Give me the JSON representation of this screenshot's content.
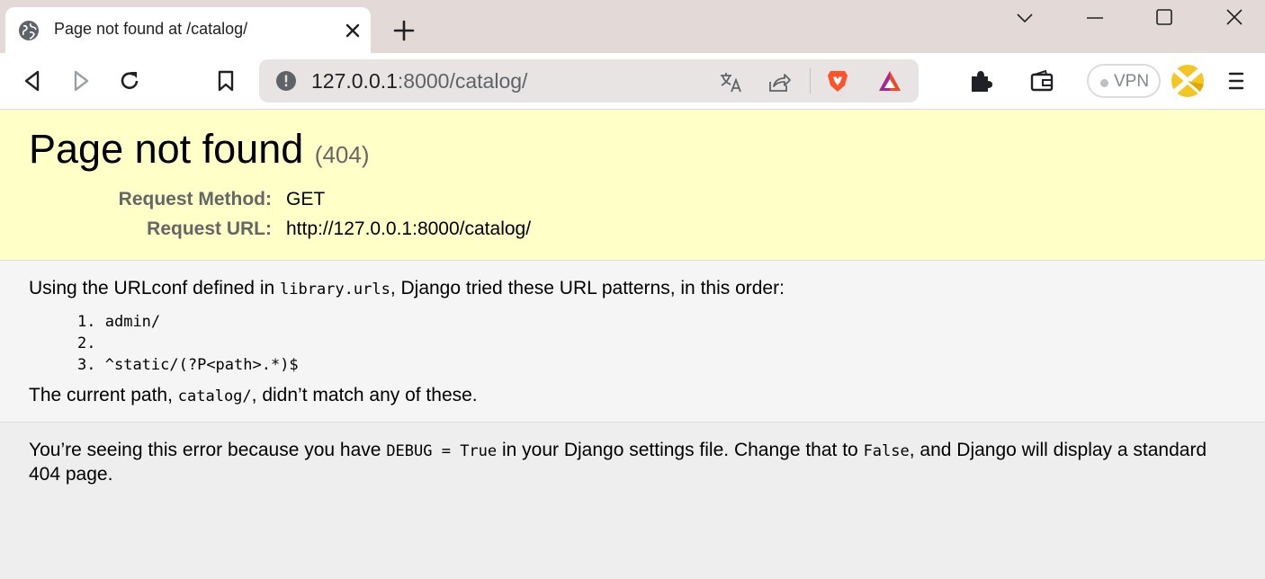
{
  "browser": {
    "tab": {
      "title": "Page not found at /catalog/",
      "favicon": "globe-icon"
    },
    "toolbar": {
      "url_host": "127.0.0.1",
      "url_rest": ":8000/catalog/",
      "vpn_label": "VPN"
    },
    "icons": [
      "globe-icon",
      "close-icon",
      "plus-icon",
      "chevron-down-icon",
      "minimize-icon",
      "maximize-icon",
      "close-window-icon",
      "back-icon",
      "forward-icon",
      "reload-icon",
      "bookmark-icon",
      "info-icon",
      "translate-icon",
      "share-icon",
      "brave-shields-icon",
      "brave-rewards-icon",
      "extensions-icon",
      "wallet-icon",
      "profile-icon",
      "menu-icon"
    ]
  },
  "page": {
    "title": "Page not found",
    "status_code": "(404)",
    "request_method_label": "Request Method:",
    "request_method": "GET",
    "request_url_label": "Request URL:",
    "request_url": "http://127.0.0.1:8000/catalog/",
    "urlconf_intro_before": "Using the URLconf defined in ",
    "urlconf_module": "library.urls",
    "urlconf_intro_after": ", Django tried these URL patterns, in this order:",
    "patterns": [
      {
        "num": "1.",
        "pattern": "admin/"
      },
      {
        "num": "2.",
        "pattern": ""
      },
      {
        "num": "3.",
        "pattern": "^static/(?P<path>.*)$"
      }
    ],
    "current_path_before": "The current path, ",
    "current_path": "catalog/",
    "current_path_after": ", didn’t match any of these.",
    "explanation_1": "You’re seeing this error because you have ",
    "debug_setting": "DEBUG = True",
    "explanation_2": " in your Django settings file. Change that to ",
    "false_value": "False",
    "explanation_3": ", and Django will display a standard 404 page."
  },
  "colors": {
    "summary_bg": "#ffffc8",
    "info_bg": "#f5f5f5",
    "page_bg": "#eeeeee",
    "tabstrip_bg": "#e3dad8",
    "brave_orange": "#fb542b"
  }
}
